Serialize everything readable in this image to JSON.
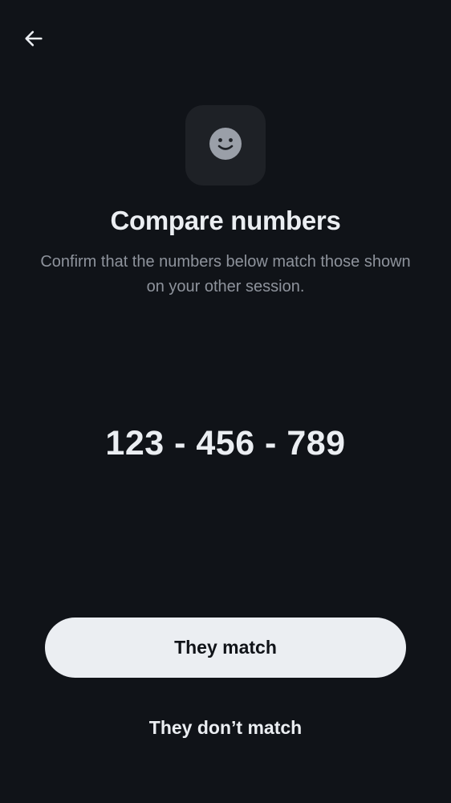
{
  "header": {
    "back_icon": "arrow-left-icon"
  },
  "hero": {
    "icon": "smiley-face-icon"
  },
  "content": {
    "title": "Compare numbers",
    "subtitle": "Confirm that the numbers below match those shown on your other session.",
    "numbers": "123 - 456 - 789"
  },
  "actions": {
    "confirm_label": "They match",
    "reject_label": "They don’t match"
  },
  "colors": {
    "background": "#101318",
    "surface": "#1E2126",
    "primary_text": "#EBEEF2",
    "secondary_text": "#8E939C",
    "icon": "#9A9FA8"
  }
}
